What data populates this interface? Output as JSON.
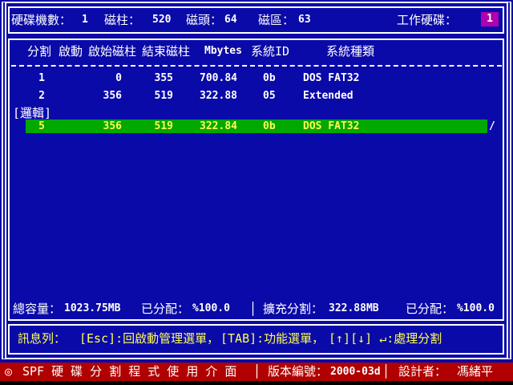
{
  "colors": {
    "background_blue": "#0a0aa8",
    "selection_green": "#00a800",
    "selection_text_yellow": "#ffff54",
    "workdisk_magenta": "#b000b0",
    "footer_red": "#b00000",
    "border_white": "#ffffff"
  },
  "top_bar": {
    "drives_label": "硬碟機數：",
    "drives_value": "1",
    "cylinders_label": "磁柱：",
    "cylinders_value": "520",
    "heads_label": "磁頭：",
    "heads_value": "64",
    "sectors_label": "磁區：",
    "sectors_value": "63",
    "working_disk_label": "工作硬碟：",
    "working_disk_value": "1"
  },
  "table": {
    "columns": {
      "partition": "分割",
      "boot": "啟動",
      "start_cyl": "啟始磁柱",
      "end_cyl": "結束磁柱",
      "mbytes": "Mbytes",
      "system_id": "系統ID",
      "system_type": "系統種類"
    },
    "primary_rows": [
      {
        "num": "1",
        "start": "0",
        "end": "355",
        "mbytes": "700.84",
        "system_id": "0b",
        "system_type": "DOS FAT32"
      },
      {
        "num": "2",
        "start": "356",
        "end": "519",
        "mbytes": "322.88",
        "system_id": "05",
        "system_type": "Extended"
      }
    ],
    "logical_section_label": "[邏輯]",
    "selected_row": {
      "num": "5",
      "start": "356",
      "end": "519",
      "mbytes": "322.84",
      "system_id": "0b",
      "system_type": "DOS FAT32"
    },
    "spinner": "/"
  },
  "stats": {
    "total_label": "總容量：",
    "total_value": "1023.75MB",
    "allocated_label": "已分配：",
    "allocated_value": "%100.0",
    "separator": "│",
    "extended_label": "擴充分割：",
    "extended_value": "322.88MB",
    "extended_allocated_label": "已分配：",
    "extended_allocated_value": "%100.0"
  },
  "message_bar": {
    "label": "訊息列：",
    "esc_hint": "[Esc]:回啟動管理選單，",
    "tab_hint": "[TAB]:功能選單，",
    "arrows_hint": "[↑][↓] ↵:處理分割"
  },
  "footer": {
    "bullet": "◎",
    "title": "SPF 硬 碟 分 割 程 式 使 用 介 面",
    "separator1": "│",
    "version_label": "版本編號：",
    "version_value": "2000-03d",
    "separator2": "│",
    "designer_label": "設計者：",
    "designer_value": "馮緒平"
  }
}
